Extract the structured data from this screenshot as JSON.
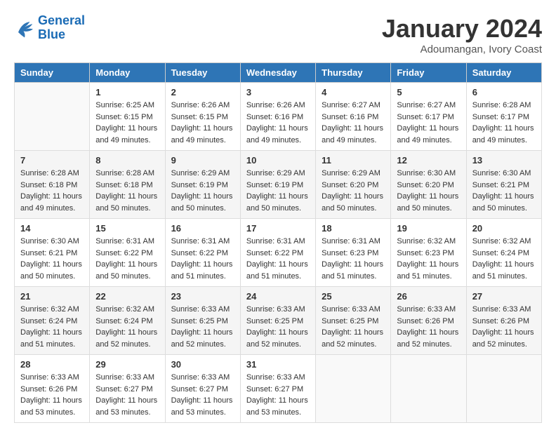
{
  "logo": {
    "line1": "General",
    "line2": "Blue"
  },
  "title": "January 2024",
  "subtitle": "Adoumangan, Ivory Coast",
  "days_of_week": [
    "Sunday",
    "Monday",
    "Tuesday",
    "Wednesday",
    "Thursday",
    "Friday",
    "Saturday"
  ],
  "weeks": [
    [
      {
        "day": "",
        "info": ""
      },
      {
        "day": "1",
        "info": "Sunrise: 6:25 AM\nSunset: 6:15 PM\nDaylight: 11 hours\nand 49 minutes."
      },
      {
        "day": "2",
        "info": "Sunrise: 6:26 AM\nSunset: 6:15 PM\nDaylight: 11 hours\nand 49 minutes."
      },
      {
        "day": "3",
        "info": "Sunrise: 6:26 AM\nSunset: 6:16 PM\nDaylight: 11 hours\nand 49 minutes."
      },
      {
        "day": "4",
        "info": "Sunrise: 6:27 AM\nSunset: 6:16 PM\nDaylight: 11 hours\nand 49 minutes."
      },
      {
        "day": "5",
        "info": "Sunrise: 6:27 AM\nSunset: 6:17 PM\nDaylight: 11 hours\nand 49 minutes."
      },
      {
        "day": "6",
        "info": "Sunrise: 6:28 AM\nSunset: 6:17 PM\nDaylight: 11 hours\nand 49 minutes."
      }
    ],
    [
      {
        "day": "7",
        "info": "Sunrise: 6:28 AM\nSunset: 6:18 PM\nDaylight: 11 hours\nand 49 minutes."
      },
      {
        "day": "8",
        "info": "Sunrise: 6:28 AM\nSunset: 6:18 PM\nDaylight: 11 hours\nand 50 minutes."
      },
      {
        "day": "9",
        "info": "Sunrise: 6:29 AM\nSunset: 6:19 PM\nDaylight: 11 hours\nand 50 minutes."
      },
      {
        "day": "10",
        "info": "Sunrise: 6:29 AM\nSunset: 6:19 PM\nDaylight: 11 hours\nand 50 minutes."
      },
      {
        "day": "11",
        "info": "Sunrise: 6:29 AM\nSunset: 6:20 PM\nDaylight: 11 hours\nand 50 minutes."
      },
      {
        "day": "12",
        "info": "Sunrise: 6:30 AM\nSunset: 6:20 PM\nDaylight: 11 hours\nand 50 minutes."
      },
      {
        "day": "13",
        "info": "Sunrise: 6:30 AM\nSunset: 6:21 PM\nDaylight: 11 hours\nand 50 minutes."
      }
    ],
    [
      {
        "day": "14",
        "info": "Sunrise: 6:30 AM\nSunset: 6:21 PM\nDaylight: 11 hours\nand 50 minutes."
      },
      {
        "day": "15",
        "info": "Sunrise: 6:31 AM\nSunset: 6:22 PM\nDaylight: 11 hours\nand 50 minutes."
      },
      {
        "day": "16",
        "info": "Sunrise: 6:31 AM\nSunset: 6:22 PM\nDaylight: 11 hours\nand 51 minutes."
      },
      {
        "day": "17",
        "info": "Sunrise: 6:31 AM\nSunset: 6:22 PM\nDaylight: 11 hours\nand 51 minutes."
      },
      {
        "day": "18",
        "info": "Sunrise: 6:31 AM\nSunset: 6:23 PM\nDaylight: 11 hours\nand 51 minutes."
      },
      {
        "day": "19",
        "info": "Sunrise: 6:32 AM\nSunset: 6:23 PM\nDaylight: 11 hours\nand 51 minutes."
      },
      {
        "day": "20",
        "info": "Sunrise: 6:32 AM\nSunset: 6:24 PM\nDaylight: 11 hours\nand 51 minutes."
      }
    ],
    [
      {
        "day": "21",
        "info": "Sunrise: 6:32 AM\nSunset: 6:24 PM\nDaylight: 11 hours\nand 51 minutes."
      },
      {
        "day": "22",
        "info": "Sunrise: 6:32 AM\nSunset: 6:24 PM\nDaylight: 11 hours\nand 52 minutes."
      },
      {
        "day": "23",
        "info": "Sunrise: 6:33 AM\nSunset: 6:25 PM\nDaylight: 11 hours\nand 52 minutes."
      },
      {
        "day": "24",
        "info": "Sunrise: 6:33 AM\nSunset: 6:25 PM\nDaylight: 11 hours\nand 52 minutes."
      },
      {
        "day": "25",
        "info": "Sunrise: 6:33 AM\nSunset: 6:25 PM\nDaylight: 11 hours\nand 52 minutes."
      },
      {
        "day": "26",
        "info": "Sunrise: 6:33 AM\nSunset: 6:26 PM\nDaylight: 11 hours\nand 52 minutes."
      },
      {
        "day": "27",
        "info": "Sunrise: 6:33 AM\nSunset: 6:26 PM\nDaylight: 11 hours\nand 52 minutes."
      }
    ],
    [
      {
        "day": "28",
        "info": "Sunrise: 6:33 AM\nSunset: 6:26 PM\nDaylight: 11 hours\nand 53 minutes."
      },
      {
        "day": "29",
        "info": "Sunrise: 6:33 AM\nSunset: 6:27 PM\nDaylight: 11 hours\nand 53 minutes."
      },
      {
        "day": "30",
        "info": "Sunrise: 6:33 AM\nSunset: 6:27 PM\nDaylight: 11 hours\nand 53 minutes."
      },
      {
        "day": "31",
        "info": "Sunrise: 6:33 AM\nSunset: 6:27 PM\nDaylight: 11 hours\nand 53 minutes."
      },
      {
        "day": "",
        "info": ""
      },
      {
        "day": "",
        "info": ""
      },
      {
        "day": "",
        "info": ""
      }
    ]
  ]
}
